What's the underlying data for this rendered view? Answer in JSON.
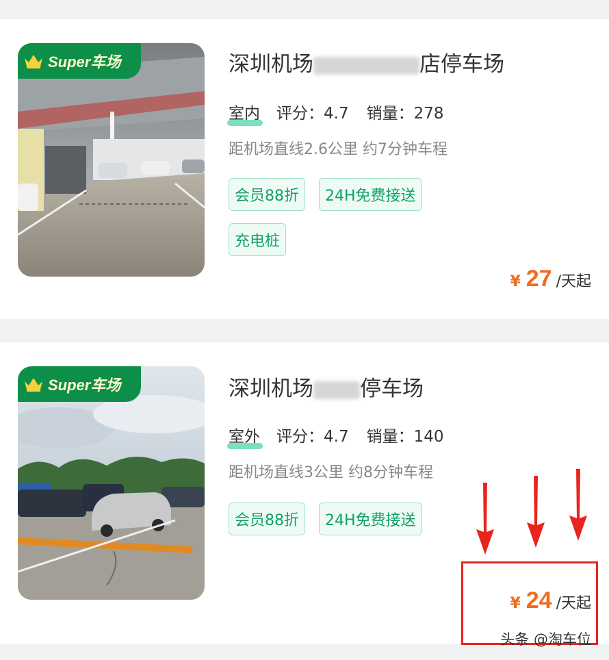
{
  "listings": [
    {
      "badge": "Super车场",
      "title_prefix": "深圳机场",
      "title_suffix": "店停车场",
      "location_type": "室内",
      "rating_label": "评分：",
      "rating_value": "4.7",
      "sales_label": "销量：",
      "sales_value": "278",
      "distance": "距机场直线2.6公里 约7分钟车程",
      "tags": [
        "会员88折",
        "24H免费接送",
        "充电桩"
      ],
      "currency": "¥",
      "price": "27",
      "price_unit": "/天起"
    },
    {
      "badge": "Super车场",
      "title_prefix": "深圳机场",
      "title_suffix": "停车场",
      "location_type": "室外",
      "rating_label": "评分：",
      "rating_value": "4.7",
      "sales_label": "销量：",
      "sales_value": "140",
      "distance": "距机场直线3公里 约8分钟车程",
      "tags": [
        "会员88折",
        "24H免费接送"
      ],
      "currency": "¥",
      "price": "24",
      "price_unit": "/天起"
    }
  ],
  "watermark": "头条 @淘车位",
  "colors": {
    "badge_green": "#0d8f4a",
    "tag_text": "#119f6a",
    "price_orange": "#f06b1e",
    "annotation_red": "#e8241d"
  }
}
